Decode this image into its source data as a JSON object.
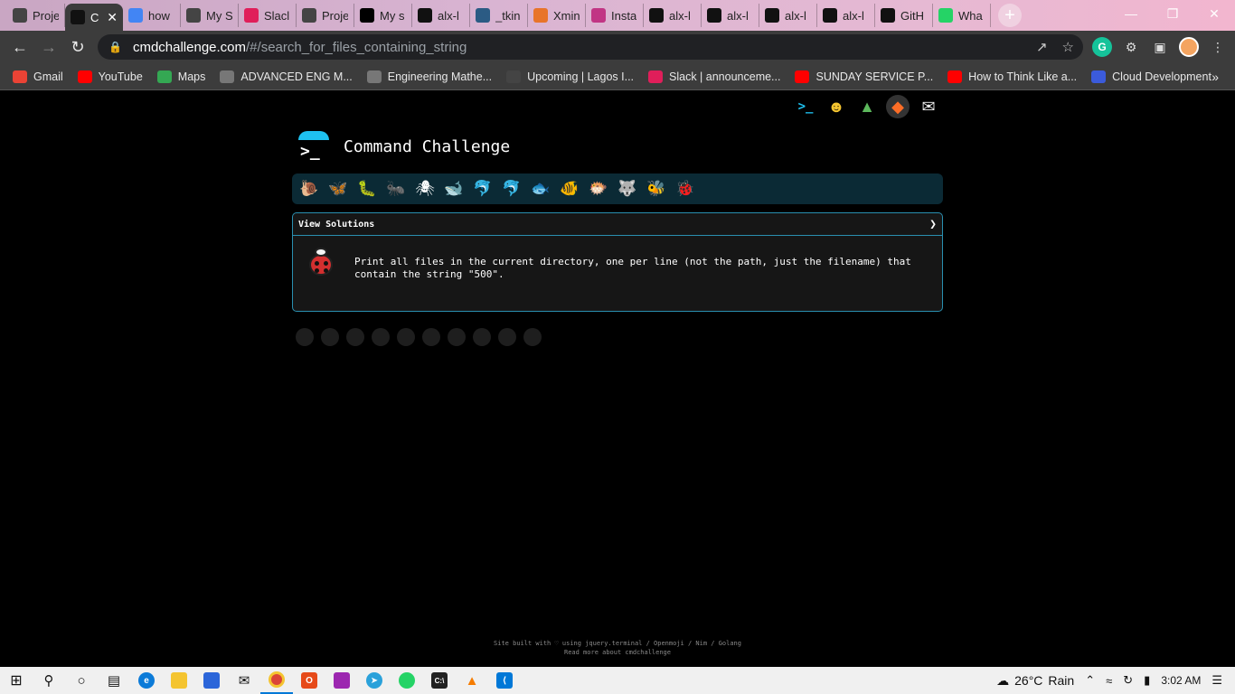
{
  "browser": {
    "tabs": [
      {
        "title": "Proje",
        "favicon": "alx-icon",
        "color": "#444"
      },
      {
        "title": "C",
        "favicon": "terminal-icon",
        "color": "#111",
        "active": true
      },
      {
        "title": "how",
        "favicon": "google-icon",
        "color": "#4285f4"
      },
      {
        "title": "My S",
        "favicon": "alx-icon",
        "color": "#444"
      },
      {
        "title": "Slacl",
        "favicon": "slack-icon",
        "color": "#e01e5a"
      },
      {
        "title": "Proje",
        "favicon": "alx-icon",
        "color": "#444"
      },
      {
        "title": "My s",
        "favicon": "medium-icon",
        "color": "#000"
      },
      {
        "title": "alx-l",
        "favicon": "github-icon",
        "color": "#111"
      },
      {
        "title": "_tkin",
        "favicon": "python-icon",
        "color": "#2b5b84"
      },
      {
        "title": "Xmin",
        "favicon": "xmind-icon",
        "color": "#e8742a"
      },
      {
        "title": "Insta",
        "favicon": "instagram-icon",
        "color": "#c13584"
      },
      {
        "title": "alx-l",
        "favicon": "github-icon",
        "color": "#111"
      },
      {
        "title": "alx-l",
        "favicon": "github-icon",
        "color": "#111"
      },
      {
        "title": "alx-l",
        "favicon": "github-icon",
        "color": "#111"
      },
      {
        "title": "alx-l",
        "favicon": "github-icon",
        "color": "#111"
      },
      {
        "title": "GitH",
        "favicon": "github-icon",
        "color": "#111"
      },
      {
        "title": "Wha",
        "favicon": "whatsapp-icon",
        "color": "#25d366"
      }
    ],
    "url_host": "cmdchallenge.com",
    "url_path": "/#/search_for_files_containing_string",
    "bookmarks": [
      {
        "label": "Gmail",
        "icon": "gmail-icon",
        "color": "#ea4335"
      },
      {
        "label": "YouTube",
        "icon": "youtube-icon",
        "color": "#ff0000"
      },
      {
        "label": "Maps",
        "icon": "maps-icon",
        "color": "#34a853"
      },
      {
        "label": "ADVANCED ENG M...",
        "icon": "globe-icon",
        "color": "#777"
      },
      {
        "label": "Engineering Mathe...",
        "icon": "globe-icon",
        "color": "#777"
      },
      {
        "label": "Upcoming | Lagos I...",
        "icon": "alx-icon",
        "color": "#444"
      },
      {
        "label": "Slack | announceme...",
        "icon": "slack-icon",
        "color": "#e01e5a"
      },
      {
        "label": "SUNDAY SERVICE P...",
        "icon": "youtube-icon",
        "color": "#ff0000"
      },
      {
        "label": "How to Think Like a...",
        "icon": "youtube-icon",
        "color": "#ff0000"
      },
      {
        "label": "Cloud Development",
        "icon": "cloud-icon",
        "color": "#3b5bdb"
      }
    ]
  },
  "page": {
    "title": "Command Challenge",
    "header_icons": [
      "terminal-icon",
      "emoji-icon",
      "tree-icon",
      "gitlab-icon",
      "mail-icon"
    ],
    "level_icons": [
      "🐌",
      "🦋",
      "🐛",
      "🐜",
      "🕷",
      "🐋",
      "🐬",
      "🐬",
      "🐟",
      "🐠",
      "🐡",
      "🐺",
      "🐝",
      "🐞"
    ],
    "view_solutions_label": "View Solutions",
    "task_text": "Print all files in the current directory, one per line (not the path, just the filename) that contain the string \"500\".",
    "footer_line1": "Site built with ♡ using jquery.terminal / Openmoji / Nim / Golang",
    "footer_line2": "Read more about cmdchallenge"
  },
  "taskbar": {
    "weather_temp": "26°C",
    "weather_text": "Rain",
    "time": "3:02 AM"
  }
}
